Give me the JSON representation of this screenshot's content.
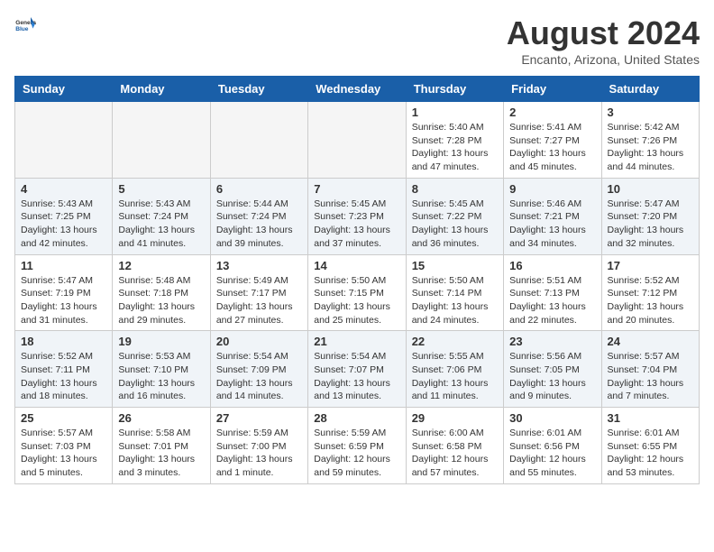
{
  "logo": {
    "general": "General",
    "blue": "Blue"
  },
  "title": "August 2024",
  "subtitle": "Encanto, Arizona, United States",
  "weekdays": [
    "Sunday",
    "Monday",
    "Tuesday",
    "Wednesday",
    "Thursday",
    "Friday",
    "Saturday"
  ],
  "weeks": [
    [
      {
        "day": "",
        "info": ""
      },
      {
        "day": "",
        "info": ""
      },
      {
        "day": "",
        "info": ""
      },
      {
        "day": "",
        "info": ""
      },
      {
        "day": "1",
        "info": "Sunrise: 5:40 AM\nSunset: 7:28 PM\nDaylight: 13 hours\nand 47 minutes."
      },
      {
        "day": "2",
        "info": "Sunrise: 5:41 AM\nSunset: 7:27 PM\nDaylight: 13 hours\nand 45 minutes."
      },
      {
        "day": "3",
        "info": "Sunrise: 5:42 AM\nSunset: 7:26 PM\nDaylight: 13 hours\nand 44 minutes."
      }
    ],
    [
      {
        "day": "4",
        "info": "Sunrise: 5:43 AM\nSunset: 7:25 PM\nDaylight: 13 hours\nand 42 minutes."
      },
      {
        "day": "5",
        "info": "Sunrise: 5:43 AM\nSunset: 7:24 PM\nDaylight: 13 hours\nand 41 minutes."
      },
      {
        "day": "6",
        "info": "Sunrise: 5:44 AM\nSunset: 7:24 PM\nDaylight: 13 hours\nand 39 minutes."
      },
      {
        "day": "7",
        "info": "Sunrise: 5:45 AM\nSunset: 7:23 PM\nDaylight: 13 hours\nand 37 minutes."
      },
      {
        "day": "8",
        "info": "Sunrise: 5:45 AM\nSunset: 7:22 PM\nDaylight: 13 hours\nand 36 minutes."
      },
      {
        "day": "9",
        "info": "Sunrise: 5:46 AM\nSunset: 7:21 PM\nDaylight: 13 hours\nand 34 minutes."
      },
      {
        "day": "10",
        "info": "Sunrise: 5:47 AM\nSunset: 7:20 PM\nDaylight: 13 hours\nand 32 minutes."
      }
    ],
    [
      {
        "day": "11",
        "info": "Sunrise: 5:47 AM\nSunset: 7:19 PM\nDaylight: 13 hours\nand 31 minutes."
      },
      {
        "day": "12",
        "info": "Sunrise: 5:48 AM\nSunset: 7:18 PM\nDaylight: 13 hours\nand 29 minutes."
      },
      {
        "day": "13",
        "info": "Sunrise: 5:49 AM\nSunset: 7:17 PM\nDaylight: 13 hours\nand 27 minutes."
      },
      {
        "day": "14",
        "info": "Sunrise: 5:50 AM\nSunset: 7:15 PM\nDaylight: 13 hours\nand 25 minutes."
      },
      {
        "day": "15",
        "info": "Sunrise: 5:50 AM\nSunset: 7:14 PM\nDaylight: 13 hours\nand 24 minutes."
      },
      {
        "day": "16",
        "info": "Sunrise: 5:51 AM\nSunset: 7:13 PM\nDaylight: 13 hours\nand 22 minutes."
      },
      {
        "day": "17",
        "info": "Sunrise: 5:52 AM\nSunset: 7:12 PM\nDaylight: 13 hours\nand 20 minutes."
      }
    ],
    [
      {
        "day": "18",
        "info": "Sunrise: 5:52 AM\nSunset: 7:11 PM\nDaylight: 13 hours\nand 18 minutes."
      },
      {
        "day": "19",
        "info": "Sunrise: 5:53 AM\nSunset: 7:10 PM\nDaylight: 13 hours\nand 16 minutes."
      },
      {
        "day": "20",
        "info": "Sunrise: 5:54 AM\nSunset: 7:09 PM\nDaylight: 13 hours\nand 14 minutes."
      },
      {
        "day": "21",
        "info": "Sunrise: 5:54 AM\nSunset: 7:07 PM\nDaylight: 13 hours\nand 13 minutes."
      },
      {
        "day": "22",
        "info": "Sunrise: 5:55 AM\nSunset: 7:06 PM\nDaylight: 13 hours\nand 11 minutes."
      },
      {
        "day": "23",
        "info": "Sunrise: 5:56 AM\nSunset: 7:05 PM\nDaylight: 13 hours\nand 9 minutes."
      },
      {
        "day": "24",
        "info": "Sunrise: 5:57 AM\nSunset: 7:04 PM\nDaylight: 13 hours\nand 7 minutes."
      }
    ],
    [
      {
        "day": "25",
        "info": "Sunrise: 5:57 AM\nSunset: 7:03 PM\nDaylight: 13 hours\nand 5 minutes."
      },
      {
        "day": "26",
        "info": "Sunrise: 5:58 AM\nSunset: 7:01 PM\nDaylight: 13 hours\nand 3 minutes."
      },
      {
        "day": "27",
        "info": "Sunrise: 5:59 AM\nSunset: 7:00 PM\nDaylight: 13 hours\nand 1 minute."
      },
      {
        "day": "28",
        "info": "Sunrise: 5:59 AM\nSunset: 6:59 PM\nDaylight: 12 hours\nand 59 minutes."
      },
      {
        "day": "29",
        "info": "Sunrise: 6:00 AM\nSunset: 6:58 PM\nDaylight: 12 hours\nand 57 minutes."
      },
      {
        "day": "30",
        "info": "Sunrise: 6:01 AM\nSunset: 6:56 PM\nDaylight: 12 hours\nand 55 minutes."
      },
      {
        "day": "31",
        "info": "Sunrise: 6:01 AM\nSunset: 6:55 PM\nDaylight: 12 hours\nand 53 minutes."
      }
    ]
  ]
}
